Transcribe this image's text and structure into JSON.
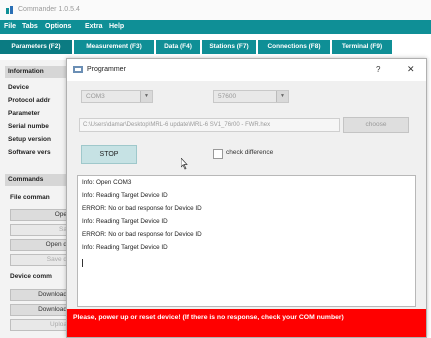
{
  "app": {
    "title": "Commander 1.0.5.4"
  },
  "menu": [
    "File",
    "Tabs",
    "Options",
    "Extra",
    "Help"
  ],
  "tabs": [
    "Parameters (F2)",
    "Measurement (F3)",
    "Data (F4)",
    "Stations (F7)",
    "Connections (F8)",
    "Terminal (F9)"
  ],
  "left_panel": {
    "information_header": "Information",
    "info_labels": [
      "Device",
      "Protocol addr",
      "Parameter",
      "Serial numbe",
      "Setup version",
      "Software vers"
    ],
    "commands_header": "Commands",
    "file_commands_header": "File comman",
    "file_buttons": [
      "Ope",
      "Sa",
      "Open d",
      "Save d"
    ],
    "device_commands_header": "Device comm",
    "device_buttons": [
      "Download",
      "Download",
      "Uploa"
    ]
  },
  "dialog": {
    "title": "Programmer",
    "help_glyph": "?",
    "close_glyph": "✕",
    "port_combo": "COM3",
    "baud_combo": "57600",
    "file_path": "C:\\Users\\damar\\Desktop\\MRL-6 update\\MRL-6 SV1_76r00 - FWR.hex",
    "choose_label": "choose",
    "stop_label": "STOP",
    "check_difference_label": "check difference",
    "log_lines": [
      "Info: Open COM3",
      "Info: Reading Target Device ID",
      "ERROR: No or bad response for Device ID",
      "Info: Reading Target Device ID",
      "ERROR: No or bad response for Device ID",
      "Info: Reading Target Device ID"
    ],
    "status_message": "Please, power up or reset device! (If there is no response, check your COM number)"
  },
  "colors": {
    "accent": "#0f8f96",
    "status_error": "#ff0000",
    "stop_button": "#c6e2e4"
  }
}
